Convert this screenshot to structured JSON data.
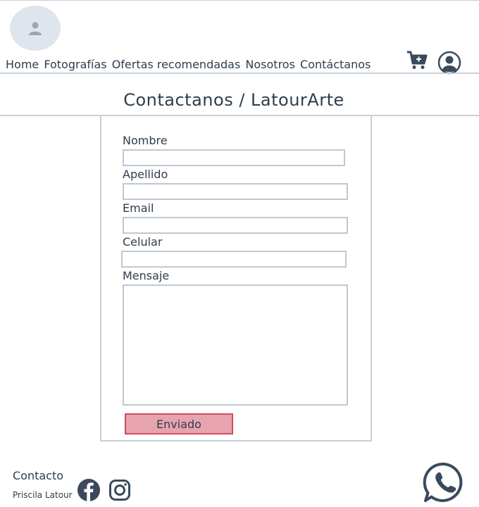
{
  "header": {
    "nav": [
      "Home",
      "Fotografías",
      "Ofertas recomendadas",
      "Nosotros",
      "Contáctanos"
    ],
    "icons": {
      "logo": "user-placeholder-icon",
      "cart": "cart-add-icon",
      "account": "user-account-icon"
    }
  },
  "page": {
    "title": "Contactanos / LatourArte"
  },
  "form": {
    "nombre_label": "Nombre",
    "nombre_value": "",
    "apellido_label": "Apellido",
    "apellido_value": "",
    "email_label": "Email",
    "email_value": "",
    "celular_label": "Celular",
    "celular_value": "",
    "mensaje_label": "Mensaje",
    "mensaje_value": "",
    "submit_label": "Enviado"
  },
  "footer": {
    "title": "Contacto",
    "name": "Priscila Latour",
    "icons": [
      "facebook-icon",
      "instagram-icon",
      "whatsapp-icon"
    ]
  },
  "colors": {
    "text": "#2f3d4c",
    "divider": "#c7d0d8",
    "button_fill": "#e8a4ae",
    "button_border": "#d04b5f",
    "logo_bg": "#dfe5ec"
  }
}
